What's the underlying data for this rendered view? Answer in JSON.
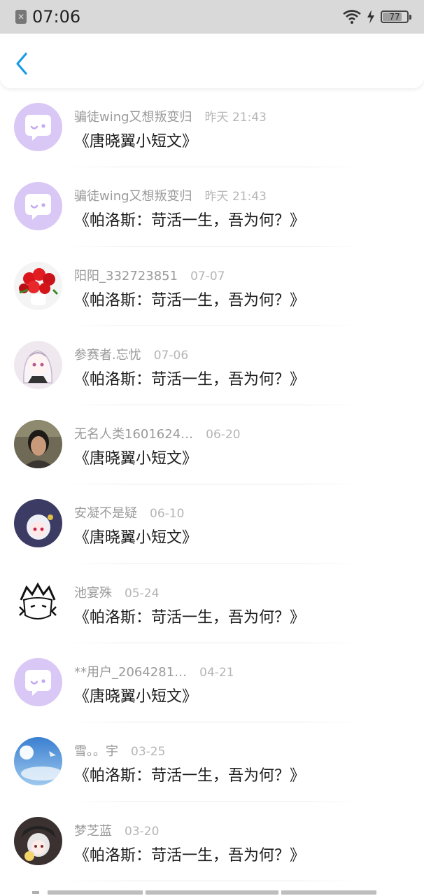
{
  "status_bar": {
    "time": "07:06",
    "battery": "77"
  },
  "header": {
    "back_icon": "chevron-left-icon",
    "accent_color": "#1a9be8"
  },
  "messages": [
    {
      "username": "骗徒wing又想叛变归",
      "time": "昨天 21:43",
      "title": "《唐晓翼小短文》",
      "avatar": "chat-bubble-default"
    },
    {
      "username": "骗徒wing又想叛变归",
      "time": "昨天 21:43",
      "title": "《帕洛斯：苛活一生，吾为何？》",
      "avatar": "chat-bubble-default"
    },
    {
      "username": "阳阳_332723851",
      "time": "07-07",
      "title": "《帕洛斯：苛活一生，吾为何？》",
      "avatar": "roses-photo"
    },
    {
      "username": "参赛者.忘忧",
      "time": "07-06",
      "title": "《帕洛斯：苛活一生，吾为何？》",
      "avatar": "anime-girl-white"
    },
    {
      "username": "无名人类1601624…",
      "time": "06-20",
      "title": "《唐晓翼小短文》",
      "avatar": "person-photo"
    },
    {
      "username": "安凝不是疑",
      "time": "06-10",
      "title": "《唐晓翼小短文》",
      "avatar": "anime-girl-hat"
    },
    {
      "username": "池宴殊",
      "time": "05-24",
      "title": "《帕洛斯：苛活一生，吾为何？》",
      "avatar": "manga-sketch"
    },
    {
      "username": "**用户_2064281…",
      "time": "04-21",
      "title": "《唐晓翼小短文》",
      "avatar": "chat-bubble-default"
    },
    {
      "username": "雪。。宇",
      "time": "03-25",
      "title": "《帕洛斯：苛活一生，吾为何？》",
      "avatar": "sky-photo"
    },
    {
      "username": "梦芝蓝",
      "time": "03-20",
      "title": "《帕洛斯：苛活一生，吾为何？》",
      "avatar": "anime-girl-flower"
    }
  ]
}
